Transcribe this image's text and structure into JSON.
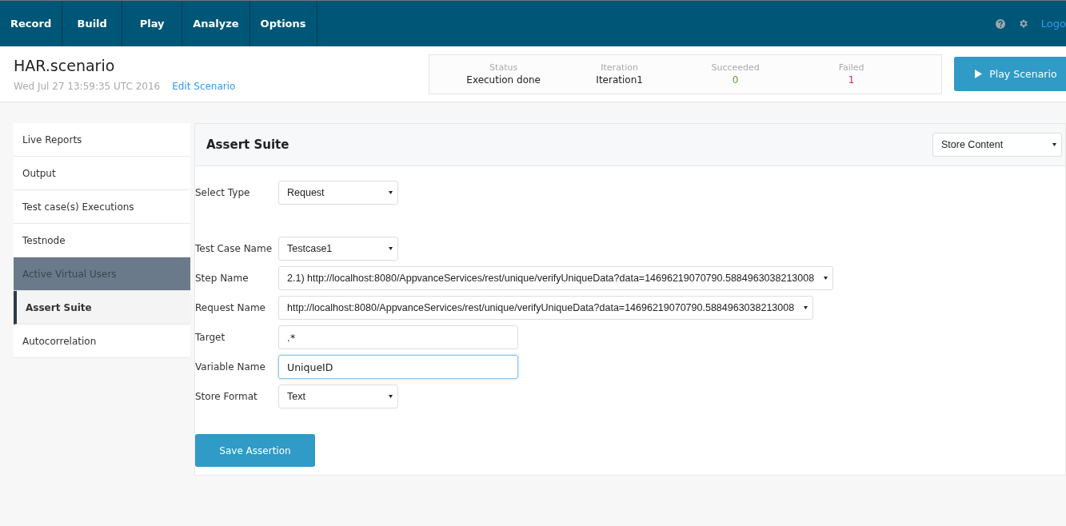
{
  "nav": {
    "tabs": [
      {
        "label": "Record",
        "selected": false
      },
      {
        "label": "Build",
        "selected": false
      },
      {
        "label": "Play",
        "selected": false
      },
      {
        "label": "Analyze",
        "selected": false
      },
      {
        "label": "Options",
        "selected": false
      }
    ],
    "logout": "Logo"
  },
  "header": {
    "title": "HAR.scenario",
    "date": "Wed Jul 27 13:59:35 UTC 2016",
    "edit_link": "Edit Scenario",
    "stats": [
      {
        "label": "Status",
        "value": "Execution done",
        "kind": "plain"
      },
      {
        "label": "Iteration",
        "value": "Iteration1",
        "kind": "plain"
      },
      {
        "label": "Succeeded",
        "value": "0",
        "kind": "success"
      },
      {
        "label": "Failed",
        "value": "1",
        "kind": "failure"
      }
    ],
    "play_button": "Play Scenario"
  },
  "sidebar": {
    "items": [
      {
        "label": "Live Reports",
        "selected": false,
        "highlighted": false
      },
      {
        "label": "Output",
        "selected": false,
        "highlighted": false
      },
      {
        "label": "Test case(s) Executions",
        "selected": false,
        "highlighted": false
      },
      {
        "label": "Testnode",
        "selected": false,
        "highlighted": false
      },
      {
        "label": "Active Virtual Users",
        "selected": false,
        "highlighted": true
      },
      {
        "label": "Assert Suite",
        "selected": true,
        "highlighted": false
      },
      {
        "label": "Autocorrelation",
        "selected": false,
        "highlighted": false
      }
    ]
  },
  "panel": {
    "title": "Assert Suite",
    "mode_select": "Store Content",
    "fields": [
      {
        "label": "Select Type",
        "kind": "select",
        "value": "Request",
        "focused": false
      },
      {
        "label": "Test Case Name",
        "kind": "select",
        "value": "Testcase1",
        "focused": false
      },
      {
        "label": "Step Name",
        "kind": "select",
        "value": "2.1) http://localhost:8080/AppvanceServices/rest/unique/verifyUniqueData?data=14696219070790.5884963038213008",
        "focused": false
      },
      {
        "label": "Request Name",
        "kind": "select",
        "value": "http://localhost:8080/AppvanceServices/rest/unique/verifyUniqueData?data=14696219070790.5884963038213008",
        "focused": false
      },
      {
        "label": "Target",
        "kind": "input",
        "value": ".*",
        "focused": false
      },
      {
        "label": "Variable Name",
        "kind": "input",
        "value": "UniqueID",
        "focused": true
      },
      {
        "label": "Store Format",
        "kind": "select",
        "value": "Text",
        "focused": false
      }
    ],
    "save_button": "Save Assertion"
  }
}
